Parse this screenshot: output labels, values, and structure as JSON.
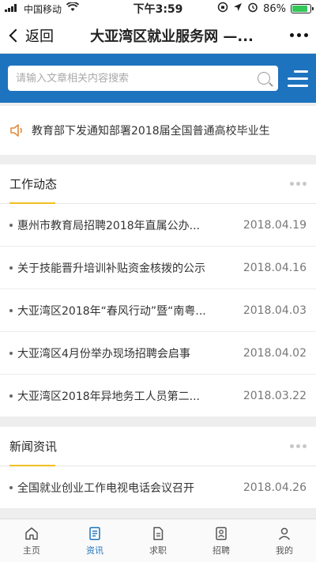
{
  "status_bar": {
    "carrier": "中国移动",
    "time": "下午3:59",
    "battery": "86%",
    "battery_level": 0.86
  },
  "navbar": {
    "back_label": "返回",
    "title": "大亚湾区就业服务网 —..."
  },
  "search": {
    "placeholder": "请输入文章相关内容搜索"
  },
  "notice": {
    "text": "教育部下发通知部署2018届全国普通高校毕业生"
  },
  "sections": [
    {
      "title": "工作动态",
      "items": [
        {
          "title": "惠州市教育局招聘2018年直属公办...",
          "date": "2018.04.19"
        },
        {
          "title": "关于技能晋升培训补贴资金核拨的公示",
          "date": "2018.04.16"
        },
        {
          "title": "大亚湾区2018年“春风行动”暨“南粤...",
          "date": "2018.04.03"
        },
        {
          "title": "大亚湾区4月份举办现场招聘会启事",
          "date": "2018.04.02"
        },
        {
          "title": "大亚湾区2018年异地务工人员第二...",
          "date": "2018.03.22"
        }
      ]
    },
    {
      "title": "新闻资讯",
      "items": [
        {
          "title": "全国就业创业工作电视电话会议召开",
          "date": "2018.04.26"
        }
      ]
    }
  ],
  "tabbar": [
    {
      "label": "主页",
      "icon": "home-icon",
      "active": false
    },
    {
      "label": "资讯",
      "icon": "news-icon",
      "active": true
    },
    {
      "label": "求职",
      "icon": "resume-icon",
      "active": false
    },
    {
      "label": "招聘",
      "icon": "recruit-icon",
      "active": false
    },
    {
      "label": "我的",
      "icon": "user-icon",
      "active": false
    }
  ],
  "colors": {
    "primary": "#1e73be",
    "accent_underline": "#f0c020"
  }
}
